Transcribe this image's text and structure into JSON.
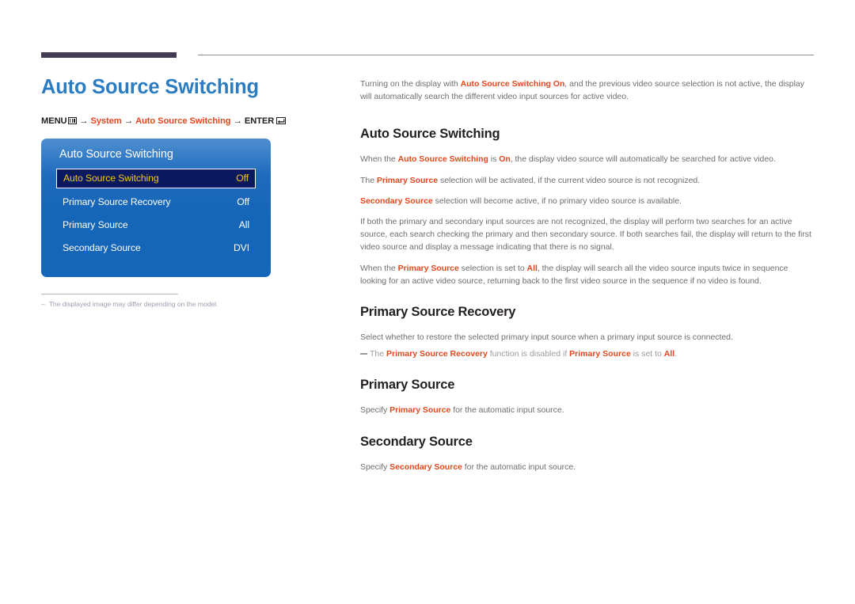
{
  "header": {
    "rule_accent_color": "#453c54",
    "rule_line_color": "#8d8d93"
  },
  "left": {
    "page_title": "Auto Source Switching",
    "breadcrumb": {
      "menu_label": "MENU",
      "menu_icon": "menu-bars-icon",
      "arrow": "→",
      "item1": "System",
      "item2": "Auto Source Switching",
      "enter_label": "ENTER",
      "enter_icon": "enter-key-icon"
    },
    "osd": {
      "title": "Auto Source Switching",
      "rows": [
        {
          "label": "Auto Source Switching",
          "value": "Off",
          "selected": true
        },
        {
          "label": "Primary Source Recovery",
          "value": "Off",
          "selected": false
        },
        {
          "label": "Primary Source",
          "value": "All",
          "selected": false
        },
        {
          "label": "Secondary Source",
          "value": "DVI",
          "selected": false
        }
      ],
      "accent_selected_text": "#f5c518",
      "panel_color": "#1565b8"
    },
    "note": {
      "dash": "–",
      "text": "The displayed image may differ depending on the model."
    }
  },
  "right": {
    "intro": "Turning on the display with <b>Auto Source Switching On</b>, and the previous video source selection is not active, the display will automatically search the different video input sources for active video.",
    "sections": [
      {
        "heading": "Auto Source Switching",
        "paragraphs": [
          "When the <b>Auto Source Switching</b> is <b>On</b>, the display video source will automatically be searched for active video.",
          "The <b>Primary Source</b> selection will be activated, if the current video source is not recognized.",
          "<b>Secondary Source</b> selection will become active, if no primary video source is available.",
          "If both the primary and secondary input sources are not recognized, the display will perform two searches for an active source, each search checking the primary and then secondary source. If both searches fail, the display will return to the first video source and display a message indicating that there is no signal.",
          "When the <b>Primary Source</b> selection is set to <b>All</b>, the display will search all the video source inputs twice in sequence looking for an active video source, returning back to the first video source in the sequence if no video is found."
        ],
        "notes": []
      },
      {
        "heading": "Primary Source Recovery",
        "paragraphs": [
          "Select whether to restore the selected primary input source when a primary input source is connected."
        ],
        "notes": [
          "The <b>Primary Source Recovery</b> function is disabled if <b>Primary Source</b> is set to <b>All</b>."
        ]
      },
      {
        "heading": "Primary Source",
        "paragraphs": [
          "Specify <b>Primary Source</b> for the automatic input source."
        ],
        "notes": []
      },
      {
        "heading": "Secondary Source",
        "paragraphs": [
          "Specify <b>Secondary Source</b> for the automatic input source."
        ],
        "notes": []
      }
    ]
  }
}
